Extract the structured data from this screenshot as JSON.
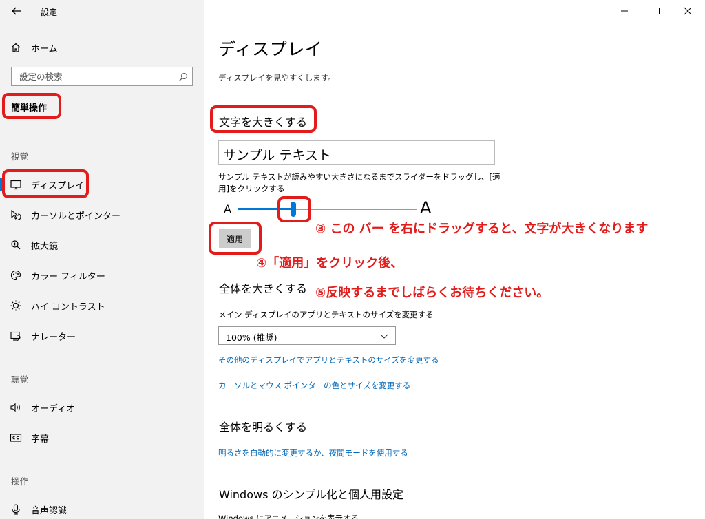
{
  "app": {
    "title": "設定"
  },
  "sidebar": {
    "home_label": "ホーム",
    "search_placeholder": "設定の検索",
    "category_title": "簡単操作",
    "groups": [
      {
        "header": "視覚",
        "items": [
          {
            "label": "ディスプレイ",
            "icon": "monitor-icon",
            "selected": true
          },
          {
            "label": "カーソルとポインター",
            "icon": "pointer-icon"
          },
          {
            "label": "拡大鏡",
            "icon": "magnifier-icon"
          },
          {
            "label": "カラー フィルター",
            "icon": "palette-icon"
          },
          {
            "label": "ハイ コントラスト",
            "icon": "contrast-icon"
          },
          {
            "label": "ナレーター",
            "icon": "narrator-icon"
          }
        ]
      },
      {
        "header": "聴覚",
        "items": [
          {
            "label": "オーディオ",
            "icon": "speaker-icon"
          },
          {
            "label": "字幕",
            "icon": "captions-icon"
          }
        ]
      },
      {
        "header": "操作",
        "items": [
          {
            "label": "音声認識",
            "icon": "microphone-icon"
          }
        ]
      }
    ]
  },
  "main": {
    "title": "ディスプレイ",
    "subtitle": "ディスプレイを見やすくします。",
    "text_size": {
      "title": "文字を大きくする",
      "sample_text": "サンプル テキスト",
      "description": "サンプル テキストが読みやすい大きさになるまでスライダーをドラッグし、[適用]をクリックする",
      "small_a": "A",
      "big_a": "A",
      "slider_value_fraction": 0.31,
      "apply_label": "適用"
    },
    "everything_bigger": {
      "title": "全体を大きくする",
      "label": "メイン ディスプレイのアプリとテキストのサイズを変更する",
      "select_value": "100% (推奨)",
      "link1": "その他のディスプレイでアプリとテキストのサイズを変更する",
      "link2": "カーソルとマウス ポインターの色とサイズを変更する"
    },
    "brightness": {
      "title": "全体を明るくする",
      "link": "明るさを自動的に変更するか、夜間モードを使用する"
    },
    "simplify": {
      "title": "Windows のシンプル化と個人用設定",
      "cut_line": "Windows にアニメーションを表示する"
    }
  },
  "annotations": {
    "step3": "③ この バー を右にドラッグすると、文字が大きくなります",
    "step4": "④「適用」をクリック後、",
    "step5": "⑤反映するまでしばらくお待ちください。"
  },
  "colors": {
    "accent": "#0078d7",
    "annotation_red": "#e21b1b",
    "link": "#0067b8",
    "sidebar_bg": "#f2f2f2"
  }
}
